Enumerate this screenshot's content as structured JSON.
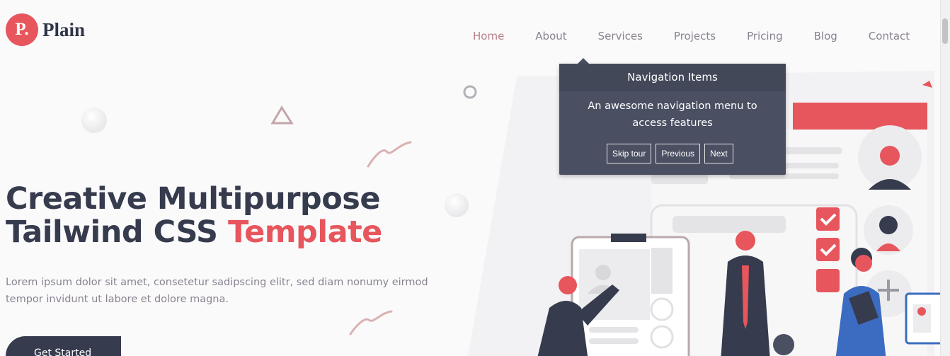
{
  "brand": {
    "logo_letter": "P.",
    "name": "Plain"
  },
  "nav": {
    "items": [
      "Home",
      "About",
      "Services",
      "Projects",
      "Pricing",
      "Blog",
      "Contact"
    ]
  },
  "tour": {
    "title": "Navigation Items",
    "body": "An awesome navigation menu to access features",
    "skip_label": "Skip tour",
    "previous_label": "Previous",
    "next_label": "Next"
  },
  "hero": {
    "title_line1": "Creative Multipurpose",
    "title_line2_start": "Tailwind CSS ",
    "title_accent": "Template",
    "description": "Lorem ipsum dolor sit amet, consetetur sadipscing elitr, sed diam nonumy eirmod tempor invidunt ut labore et dolore magna.",
    "cta_label": "Get Started"
  },
  "colors": {
    "accent": "#e7565c",
    "dark": "#363b4e",
    "tour_bg": "#4a4f62"
  }
}
